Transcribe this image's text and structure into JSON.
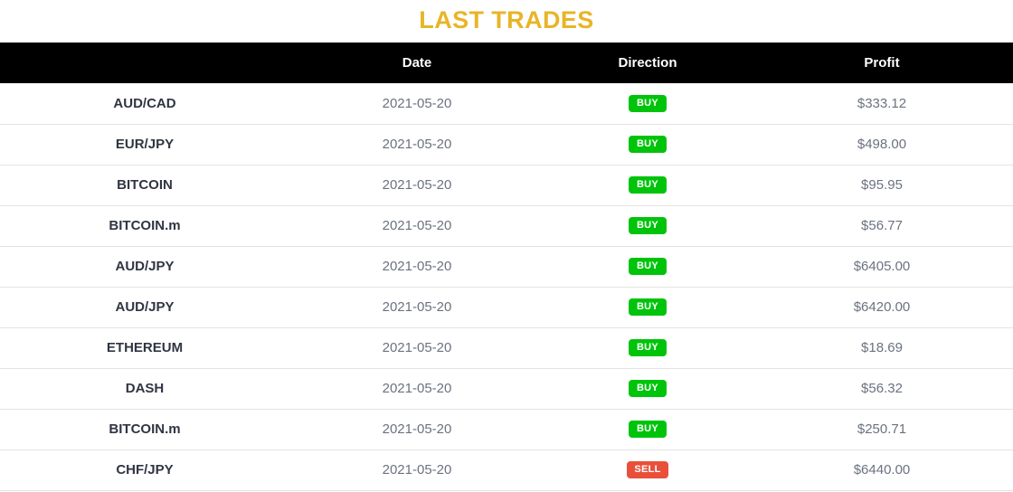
{
  "page": {
    "title": "LAST TRADES",
    "title_color": "#e8b528"
  },
  "table": {
    "header_background": "#000000",
    "header_text_color": "#ffffff",
    "columns": [
      {
        "key": "symbol",
        "label": ""
      },
      {
        "key": "date",
        "label": "Date"
      },
      {
        "key": "direction",
        "label": "Direction"
      },
      {
        "key": "profit",
        "label": "Profit"
      }
    ],
    "badge_colors": {
      "buy": "#00c40b",
      "sell": "#e8503a"
    },
    "rows": [
      {
        "symbol": "AUD/CAD",
        "date": "2021-05-20",
        "direction": "BUY",
        "direction_type": "buy",
        "profit": "$333.12"
      },
      {
        "symbol": "EUR/JPY",
        "date": "2021-05-20",
        "direction": "BUY",
        "direction_type": "buy",
        "profit": "$498.00"
      },
      {
        "symbol": "BITCOIN",
        "date": "2021-05-20",
        "direction": "BUY",
        "direction_type": "buy",
        "profit": "$95.95"
      },
      {
        "symbol": "BITCOIN.m",
        "date": "2021-05-20",
        "direction": "BUY",
        "direction_type": "buy",
        "profit": "$56.77"
      },
      {
        "symbol": "AUD/JPY",
        "date": "2021-05-20",
        "direction": "BUY",
        "direction_type": "buy",
        "profit": "$6405.00"
      },
      {
        "symbol": "AUD/JPY",
        "date": "2021-05-20",
        "direction": "BUY",
        "direction_type": "buy",
        "profit": "$6420.00"
      },
      {
        "symbol": "ETHEREUM",
        "date": "2021-05-20",
        "direction": "BUY",
        "direction_type": "buy",
        "profit": "$18.69"
      },
      {
        "symbol": "DASH",
        "date": "2021-05-20",
        "direction": "BUY",
        "direction_type": "buy",
        "profit": "$56.32"
      },
      {
        "symbol": "BITCOIN.m",
        "date": "2021-05-20",
        "direction": "BUY",
        "direction_type": "buy",
        "profit": "$250.71"
      },
      {
        "symbol": "CHF/JPY",
        "date": "2021-05-20",
        "direction": "SELL",
        "direction_type": "sell",
        "profit": "$6440.00"
      }
    ]
  }
}
